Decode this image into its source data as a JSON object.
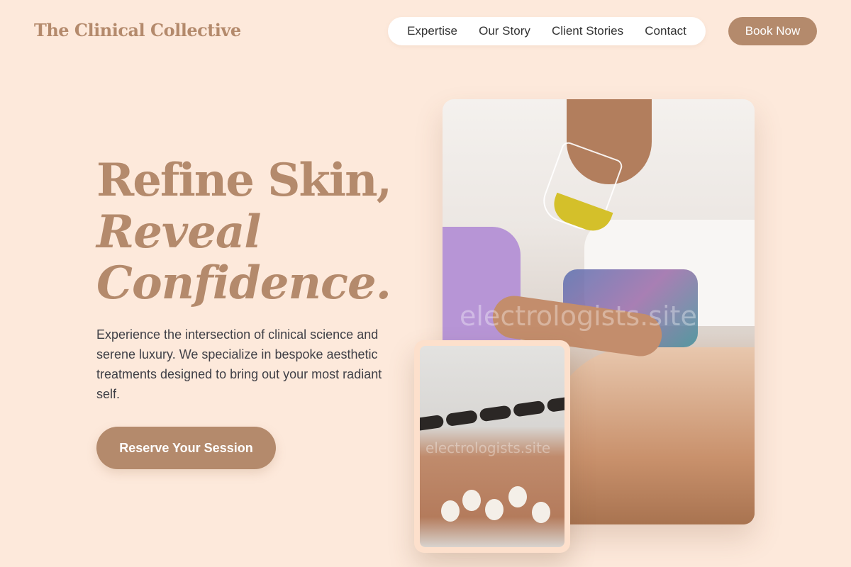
{
  "brand": {
    "logo": "The Clinical Collective"
  },
  "nav": {
    "items": [
      "Expertise",
      "Our Story",
      "Client Stories",
      "Contact"
    ],
    "book_label": "Book Now"
  },
  "hero": {
    "title_line1": "Refine Skin,",
    "title_line2": "Reveal",
    "title_line3": "Confidence.",
    "description": "Experience the intersection of clinical science and serene luxury. We specialize in bespoke aesthetic treatments designed to bring out your most radiant self.",
    "cta_label": "Reserve Your Session"
  },
  "images": {
    "main_watermark": "electrologists.site",
    "small_watermark": "electrologists.site"
  },
  "colors": {
    "background": "#fde9db",
    "accent": "#b48a6c",
    "text": "#3f3f46"
  }
}
